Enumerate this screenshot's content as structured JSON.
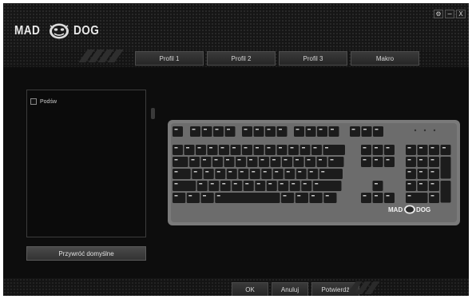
{
  "header": {
    "logo_left": "MAD",
    "logo_right": "DOG",
    "window_buttons": [
      "⚙",
      "−",
      "X"
    ]
  },
  "tabs": [
    "Profil 1",
    "Profil 2",
    "Profil 3",
    "Makro"
  ],
  "left_panel": {
    "option_label": "Podśw"
  },
  "restore_button": "Przywróć domyślne",
  "keyboard": {
    "logo_left": "MAD",
    "logo_right": "DOG"
  },
  "bottom_buttons": {
    "ok": "OK",
    "cancel": "Anuluj",
    "confirm": "Potwierdź"
  },
  "colors": {
    "background": "#0d0d0d",
    "keyboard_plate": "#7a7a7a",
    "key": "#1c1c1c",
    "key_legend": "#c8c8c8"
  }
}
